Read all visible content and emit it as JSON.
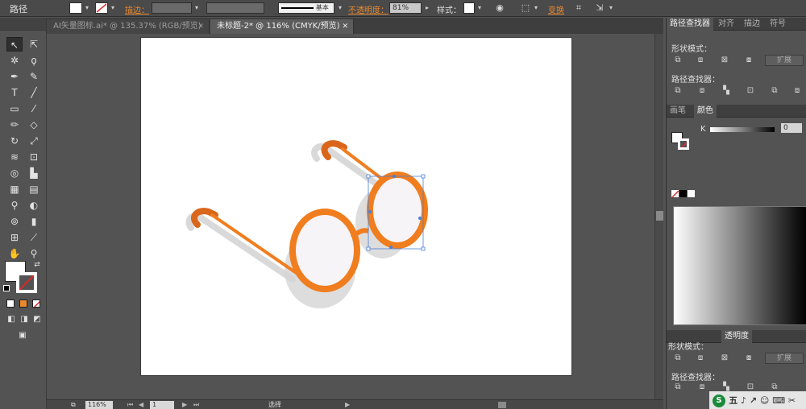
{
  "control_bar": {
    "selection_type": "路径",
    "stroke_label": "描边：",
    "stroke_style": "基本",
    "opacity_label": "不透明度：",
    "opacity_value": "81%",
    "style_label": "样式：",
    "transform_label": "变换"
  },
  "doc_tabs": [
    {
      "label": "AI矢量图标.ai* @ 135.37% (RGB/预览)",
      "active": false
    },
    {
      "label": "未标题-2* @ 116% (CMYK/预览)",
      "active": true
    }
  ],
  "status_bar": {
    "zoom": "116%",
    "page": "1",
    "mode": "选择"
  },
  "panels": {
    "pathfinder_tabs": [
      "路径查找器",
      "对齐",
      "描边",
      "符号"
    ],
    "shape_modes_label": "形状模式：",
    "pathfinders_label": "路径查找器：",
    "expand_button": "扩展",
    "color_tabs": [
      "画笔",
      "颜色"
    ],
    "k_label": "K",
    "k_value": "0",
    "bottom_tabs": [
      "透明度"
    ],
    "bottom_shape_modes_label": "形状模式：",
    "bottom_pathfinders_label": "路径查找器：",
    "bottom_expand_button": "扩展"
  },
  "watermark": {
    "text": "五 ♪ ↗ ☺ ⌨ ✂"
  },
  "colors": {
    "accent_orange": "#e8892e",
    "glasses_frame": "#f07d1e",
    "glasses_frame_dark": "#d9661a",
    "selection_blue": "#4a7fd6"
  }
}
